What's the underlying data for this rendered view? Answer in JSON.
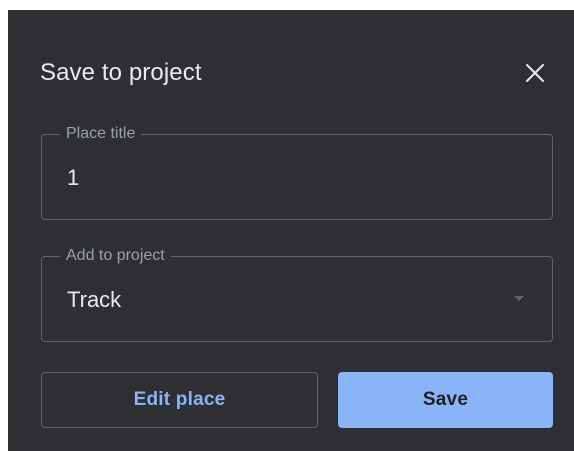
{
  "dialog": {
    "title": "Save to project",
    "close_icon": "close-icon"
  },
  "fields": {
    "place_title": {
      "label": "Place title",
      "value": "1"
    },
    "project": {
      "label": "Add to project",
      "value": "Track",
      "dropdown_icon": "dropdown-arrow-icon"
    }
  },
  "actions": {
    "edit_label": "Edit place",
    "save_label": "Save"
  },
  "colors": {
    "dialog_bg": "#2e2f33",
    "text_primary": "#e8eaed",
    "text_secondary": "#9aa0a6",
    "border": "#5f6368",
    "accent": "#8ab4f8"
  }
}
